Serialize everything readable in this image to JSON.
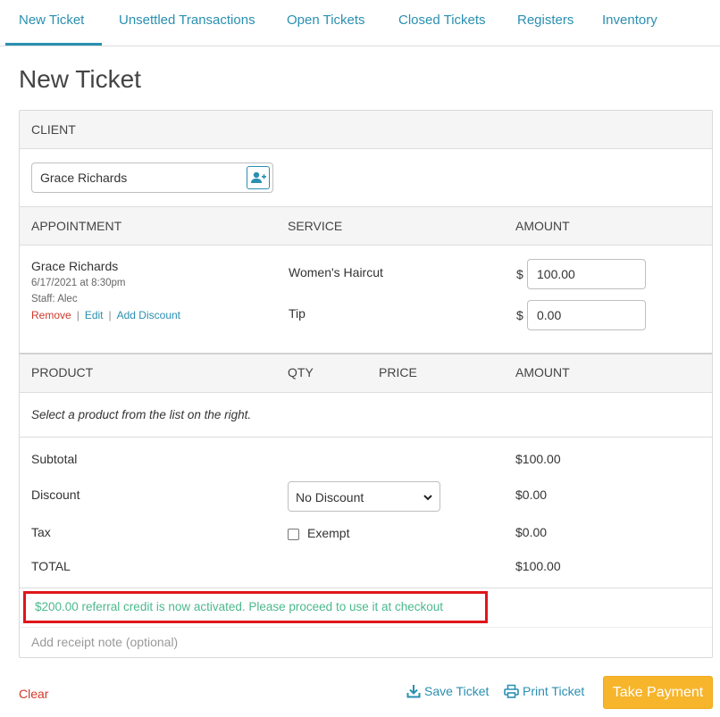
{
  "tabs": [
    {
      "label": "New Ticket"
    },
    {
      "label": "Unsettled Transactions"
    },
    {
      "label": "Open Tickets"
    },
    {
      "label": "Closed Tickets"
    },
    {
      "label": "Registers"
    },
    {
      "label": "Inventory"
    }
  ],
  "page_title": "New Ticket",
  "client": {
    "header": "CLIENT",
    "name": "Grace Richards",
    "button_icon": "add-person-icon"
  },
  "appointment": {
    "headers": {
      "appointment": "APPOINTMENT",
      "service": "SERVICE",
      "amount": "AMOUNT"
    },
    "client_name": "Grace Richards",
    "datetime": "6/17/2021 at 8:30pm",
    "staff": "Staff: Alec",
    "links": {
      "remove": "Remove",
      "edit": "Edit",
      "add_discount": "Add Discount",
      "separator": "|"
    },
    "currency": "$",
    "services": [
      {
        "label": "Women's Haircut",
        "amount": "100.00"
      },
      {
        "label": "Tip",
        "amount": "0.00"
      }
    ]
  },
  "product": {
    "headers": {
      "product": "PRODUCT",
      "qty": "QTY",
      "price": "PRICE",
      "amount": "AMOUNT"
    },
    "hint": "Select a product from the list on the right."
  },
  "totals": {
    "subtotal": {
      "label": "Subtotal",
      "amount": "$100.00"
    },
    "discount": {
      "label": "Discount",
      "selected": "No Discount",
      "amount": "$0.00"
    },
    "tax": {
      "label": "Tax",
      "exempt_label": "Exempt",
      "exempt_checked": false,
      "amount": "$0.00"
    },
    "total": {
      "label": "TOTAL",
      "amount": "$100.00"
    }
  },
  "credit_message": "$200.00 referral credit is now activated. Please proceed to use it at checkout",
  "receipt_note": {
    "placeholder": "Add receipt note (optional)",
    "value": ""
  },
  "footer": {
    "clear": "Clear",
    "save_ticket": "Save Ticket",
    "print_ticket": "Print Ticket",
    "take_payment": "Take Payment"
  },
  "colors": {
    "accent": "#2a8fb1",
    "danger": "#d0392b",
    "success_text": "#4cb88e",
    "highlight_border": "#e0161b",
    "payment_button": "#f7b52b"
  }
}
